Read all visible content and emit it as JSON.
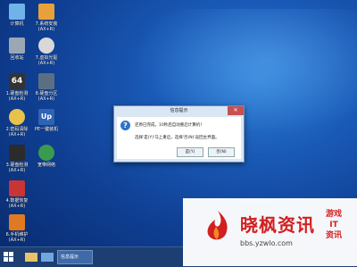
{
  "desktop_icons": [
    {
      "label": "计算机",
      "color": "#6fb3e9"
    },
    {
      "label": "7.系统安装\n(AX+R)",
      "color": "#e8a03a"
    },
    {
      "label": "回收站",
      "color": "#9aa7b5"
    },
    {
      "label": "7.虚拟光驱\n(AX+R)",
      "color": "#d8d8d8"
    },
    {
      "label": "1.硬盘检测\n(AX+R)",
      "color": "#333333"
    },
    {
      "label": "8.硬盘分区\n(AX+R)",
      "color": "#5c6f82"
    },
    {
      "label": "2.密码清除\n(AX+R)",
      "color": "#e8c24a"
    },
    {
      "label": "PE一键装机",
      "color": "#2e64b5"
    },
    {
      "label": "3.硬盘检测\n(AX+R)",
      "color": "#2b2b2b"
    },
    {
      "label": "宽带网络",
      "color": "#3a9b4f"
    },
    {
      "label": "4.数据恢复\n(AX+R)",
      "color": "#c93434"
    },
    {
      "label": "6.手机维护\n(AX+R)",
      "color": "#e07a22"
    }
  ],
  "dialog": {
    "title": "信息提示",
    "line1": "还原已完成，10秒后自动重启计算机！",
    "line2": "选择'是(Y)'马上重启，选择'否(N)'返回主界面。",
    "yes": "是(Y)",
    "no": "否(N)"
  },
  "taskbar": {
    "task_label": "信息提示"
  },
  "watermark": {
    "title": "晓枫资讯",
    "url": "bbs.yzwlo.com",
    "side": "游戏\nIT\n资讯"
  }
}
